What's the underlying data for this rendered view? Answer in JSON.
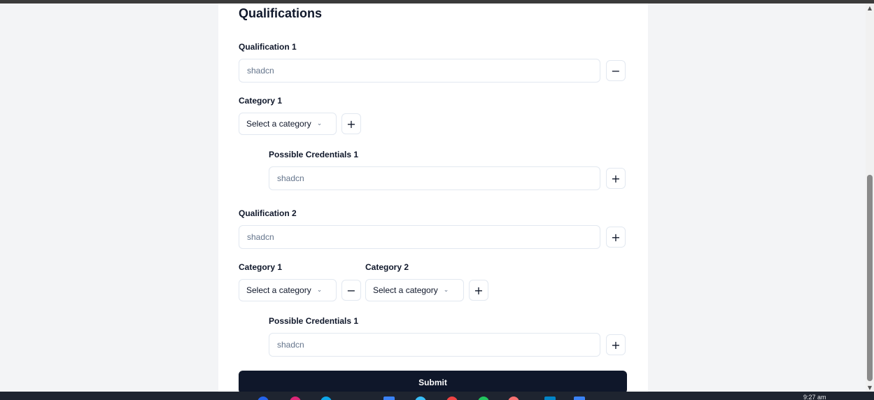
{
  "form": {
    "section_title": "Qualifications",
    "qualification_1": {
      "label": "Qualification 1",
      "placeholder": "shadcn",
      "category_1": {
        "label": "Category 1",
        "select_value": "Select a category"
      },
      "credentials_1": {
        "label": "Possible Credentials 1",
        "placeholder": "shadcn"
      }
    },
    "qualification_2": {
      "label": "Qualification 2",
      "placeholder": "shadcn",
      "category_1": {
        "label": "Category 1",
        "select_value": "Select a category"
      },
      "category_2": {
        "label": "Category 2",
        "select_value": "Select a category"
      },
      "credentials_1": {
        "label": "Possible Credentials 1",
        "placeholder": "shadcn"
      }
    },
    "buttons": {
      "minus_symbol": "−",
      "plus_symbol": "+",
      "chevron": "⌄"
    },
    "submit_label": "Submit"
  },
  "taskbar": {
    "clock": "9:27 am"
  }
}
